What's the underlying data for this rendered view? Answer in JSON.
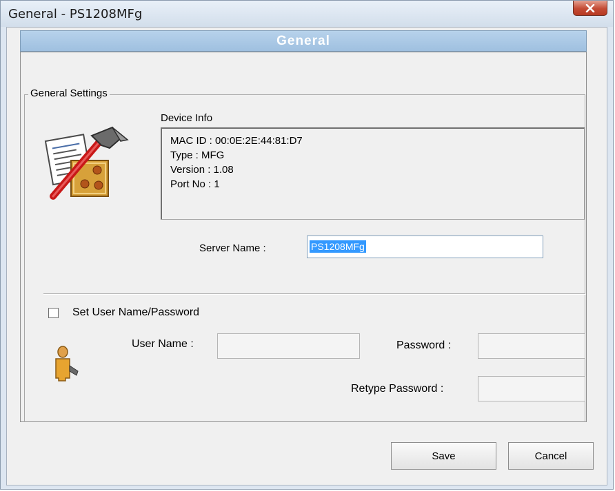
{
  "window": {
    "title": "General - PS1208MFg"
  },
  "header": {
    "title": "General"
  },
  "group": {
    "label": "General Settings"
  },
  "device_info": {
    "label": "Device Info",
    "lines": [
      "MAC ID : 00:0E:2E:44:81:D7",
      "Type : MFG",
      "Version : 1.08",
      "Port No : 1"
    ]
  },
  "server_name": {
    "label": "Server Name :",
    "value": "PS1208MFg"
  },
  "credentials": {
    "checkbox_label": "Set User Name/Password",
    "checked": false,
    "user_name_label": "User Name :",
    "user_name_value": "",
    "password_label": "Password :",
    "password_value": "",
    "retype_label": "Retype Password :",
    "retype_value": ""
  },
  "buttons": {
    "save": "Save",
    "cancel": "Cancel"
  },
  "icons": {
    "settings": "settings-tools-icon",
    "user": "user-icon",
    "close": "close-icon"
  },
  "colors": {
    "header_bg": "#a9c8e6",
    "selection": "#3399ff",
    "close_button": "#c44b35"
  }
}
